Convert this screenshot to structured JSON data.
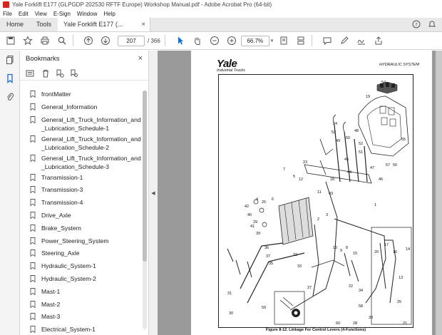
{
  "window": {
    "title": "Yale Forklift E177 (GLPGDP 202530 RFTF Europe) Workshop Manual.pdf - Adobe Acrobat Pro (64-bit)"
  },
  "menu": [
    "File",
    "Edit",
    "View",
    "E-Sign",
    "Window",
    "Help"
  ],
  "tabs": {
    "home": "Home",
    "tools": "Tools",
    "document": "Yale Forklift E177 (..."
  },
  "toolbar": {
    "current_page": "207",
    "page_count": "/ 366",
    "zoom": "66.7%"
  },
  "bookmarks": {
    "title": "Bookmarks",
    "items": [
      "frontMatter",
      "General_Information",
      "General_Lift_Truck_Information_and_Lubrication_Schedule-1",
      "General_Lift_Truck_Information_and_Lubrication_Schedule-2",
      "General_Lift_Truck_Information_and_Lubrication_Schedule-3",
      "Transmission-1",
      "Transmission-3",
      "Transmission-4",
      "Drive_Axle",
      "Brake_System",
      "Power_Steering_System",
      "Steering_Axle",
      "Hydraulic_System-1",
      "Hydraulic_System-2",
      "Mast-1",
      "Mast-2",
      "Mast-3",
      "Electrical_System-1"
    ]
  },
  "document": {
    "brand": "Yale",
    "brand_sub": "Industrial Trucks",
    "section": "HYDRAULIC SYSTEM",
    "caption": "Figure 8-12. Linkage For Control Levers (4-Functions)",
    "part_numbers": [
      "54",
      "19",
      "55",
      "24",
      "53",
      "49",
      "50",
      "52",
      "48",
      "51",
      "45",
      "7",
      "23",
      "5",
      "12",
      "47",
      "56",
      "57",
      "46",
      "26",
      "44",
      "43",
      "18",
      "11",
      "29",
      "4",
      "6",
      "1",
      "42",
      "40",
      "41",
      "39",
      "36",
      "37",
      "35",
      "3",
      "2",
      "32",
      "33",
      "30",
      "31",
      "17",
      "20",
      "16",
      "14",
      "8",
      "15",
      "13",
      "25",
      "22",
      "34",
      "59",
      "9",
      "10",
      "58",
      "38",
      "21",
      "27",
      "60",
      "28"
    ]
  },
  "colors": {
    "accent": "#d4261c",
    "doc_background": "#9a9a9a"
  }
}
